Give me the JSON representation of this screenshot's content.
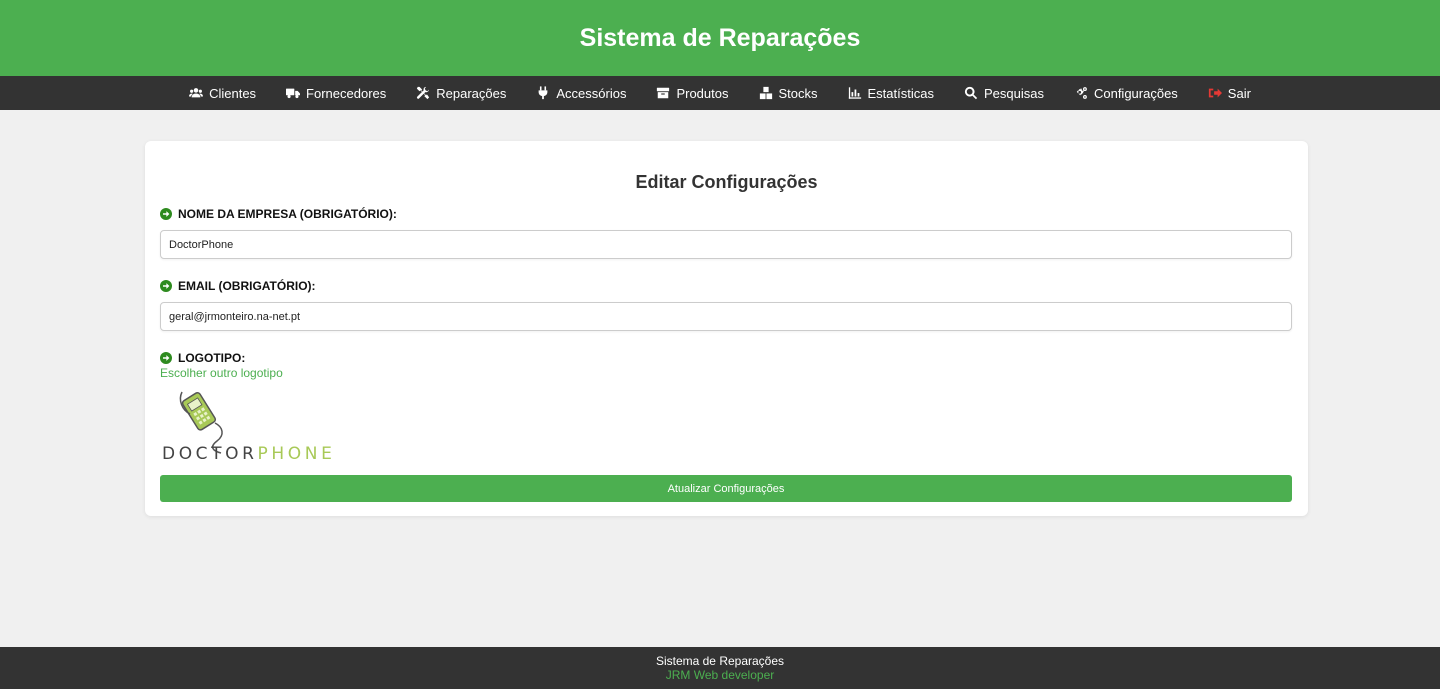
{
  "header": {
    "title": "Sistema de Reparações"
  },
  "nav": {
    "items": [
      {
        "label": "Clientes",
        "icon": "users-icon"
      },
      {
        "label": "Fornecedores",
        "icon": "truck-icon"
      },
      {
        "label": "Reparações",
        "icon": "tools-icon"
      },
      {
        "label": "Accessórios",
        "icon": "plug-icon"
      },
      {
        "label": "Produtos",
        "icon": "box-icon"
      },
      {
        "label": "Stocks",
        "icon": "boxes-icon"
      },
      {
        "label": "Estatísticas",
        "icon": "chart-icon"
      },
      {
        "label": "Pesquisas",
        "icon": "search-icon"
      },
      {
        "label": "Configurações",
        "icon": "cogs-icon"
      },
      {
        "label": "Sair",
        "icon": "sign-out-icon"
      }
    ]
  },
  "form": {
    "title": "Editar Configurações",
    "company_label": "NOME DA EMPRESA (OBRIGATÓRIO):",
    "company_value": "DoctorPhone",
    "email_label": "EMAIL (OBRIGATÓRIO):",
    "email_value": "geral@jrmonteiro.na-net.pt",
    "logo_label": "LOGOTIPO:",
    "logo_link": "Escolher outro logotipo",
    "logo_text_dark": "DOCTOR",
    "logo_text_green": "PHONE",
    "submit_label": "Atualizar Configurações"
  },
  "footer": {
    "line1": "Sistema de Reparações",
    "line2": "JRM Web developer"
  },
  "colors": {
    "primary_green": "#4caf50",
    "dark": "#333333",
    "background": "#f0f0f0",
    "logout_red": "#e53935",
    "logo_green": "#a8c957"
  }
}
